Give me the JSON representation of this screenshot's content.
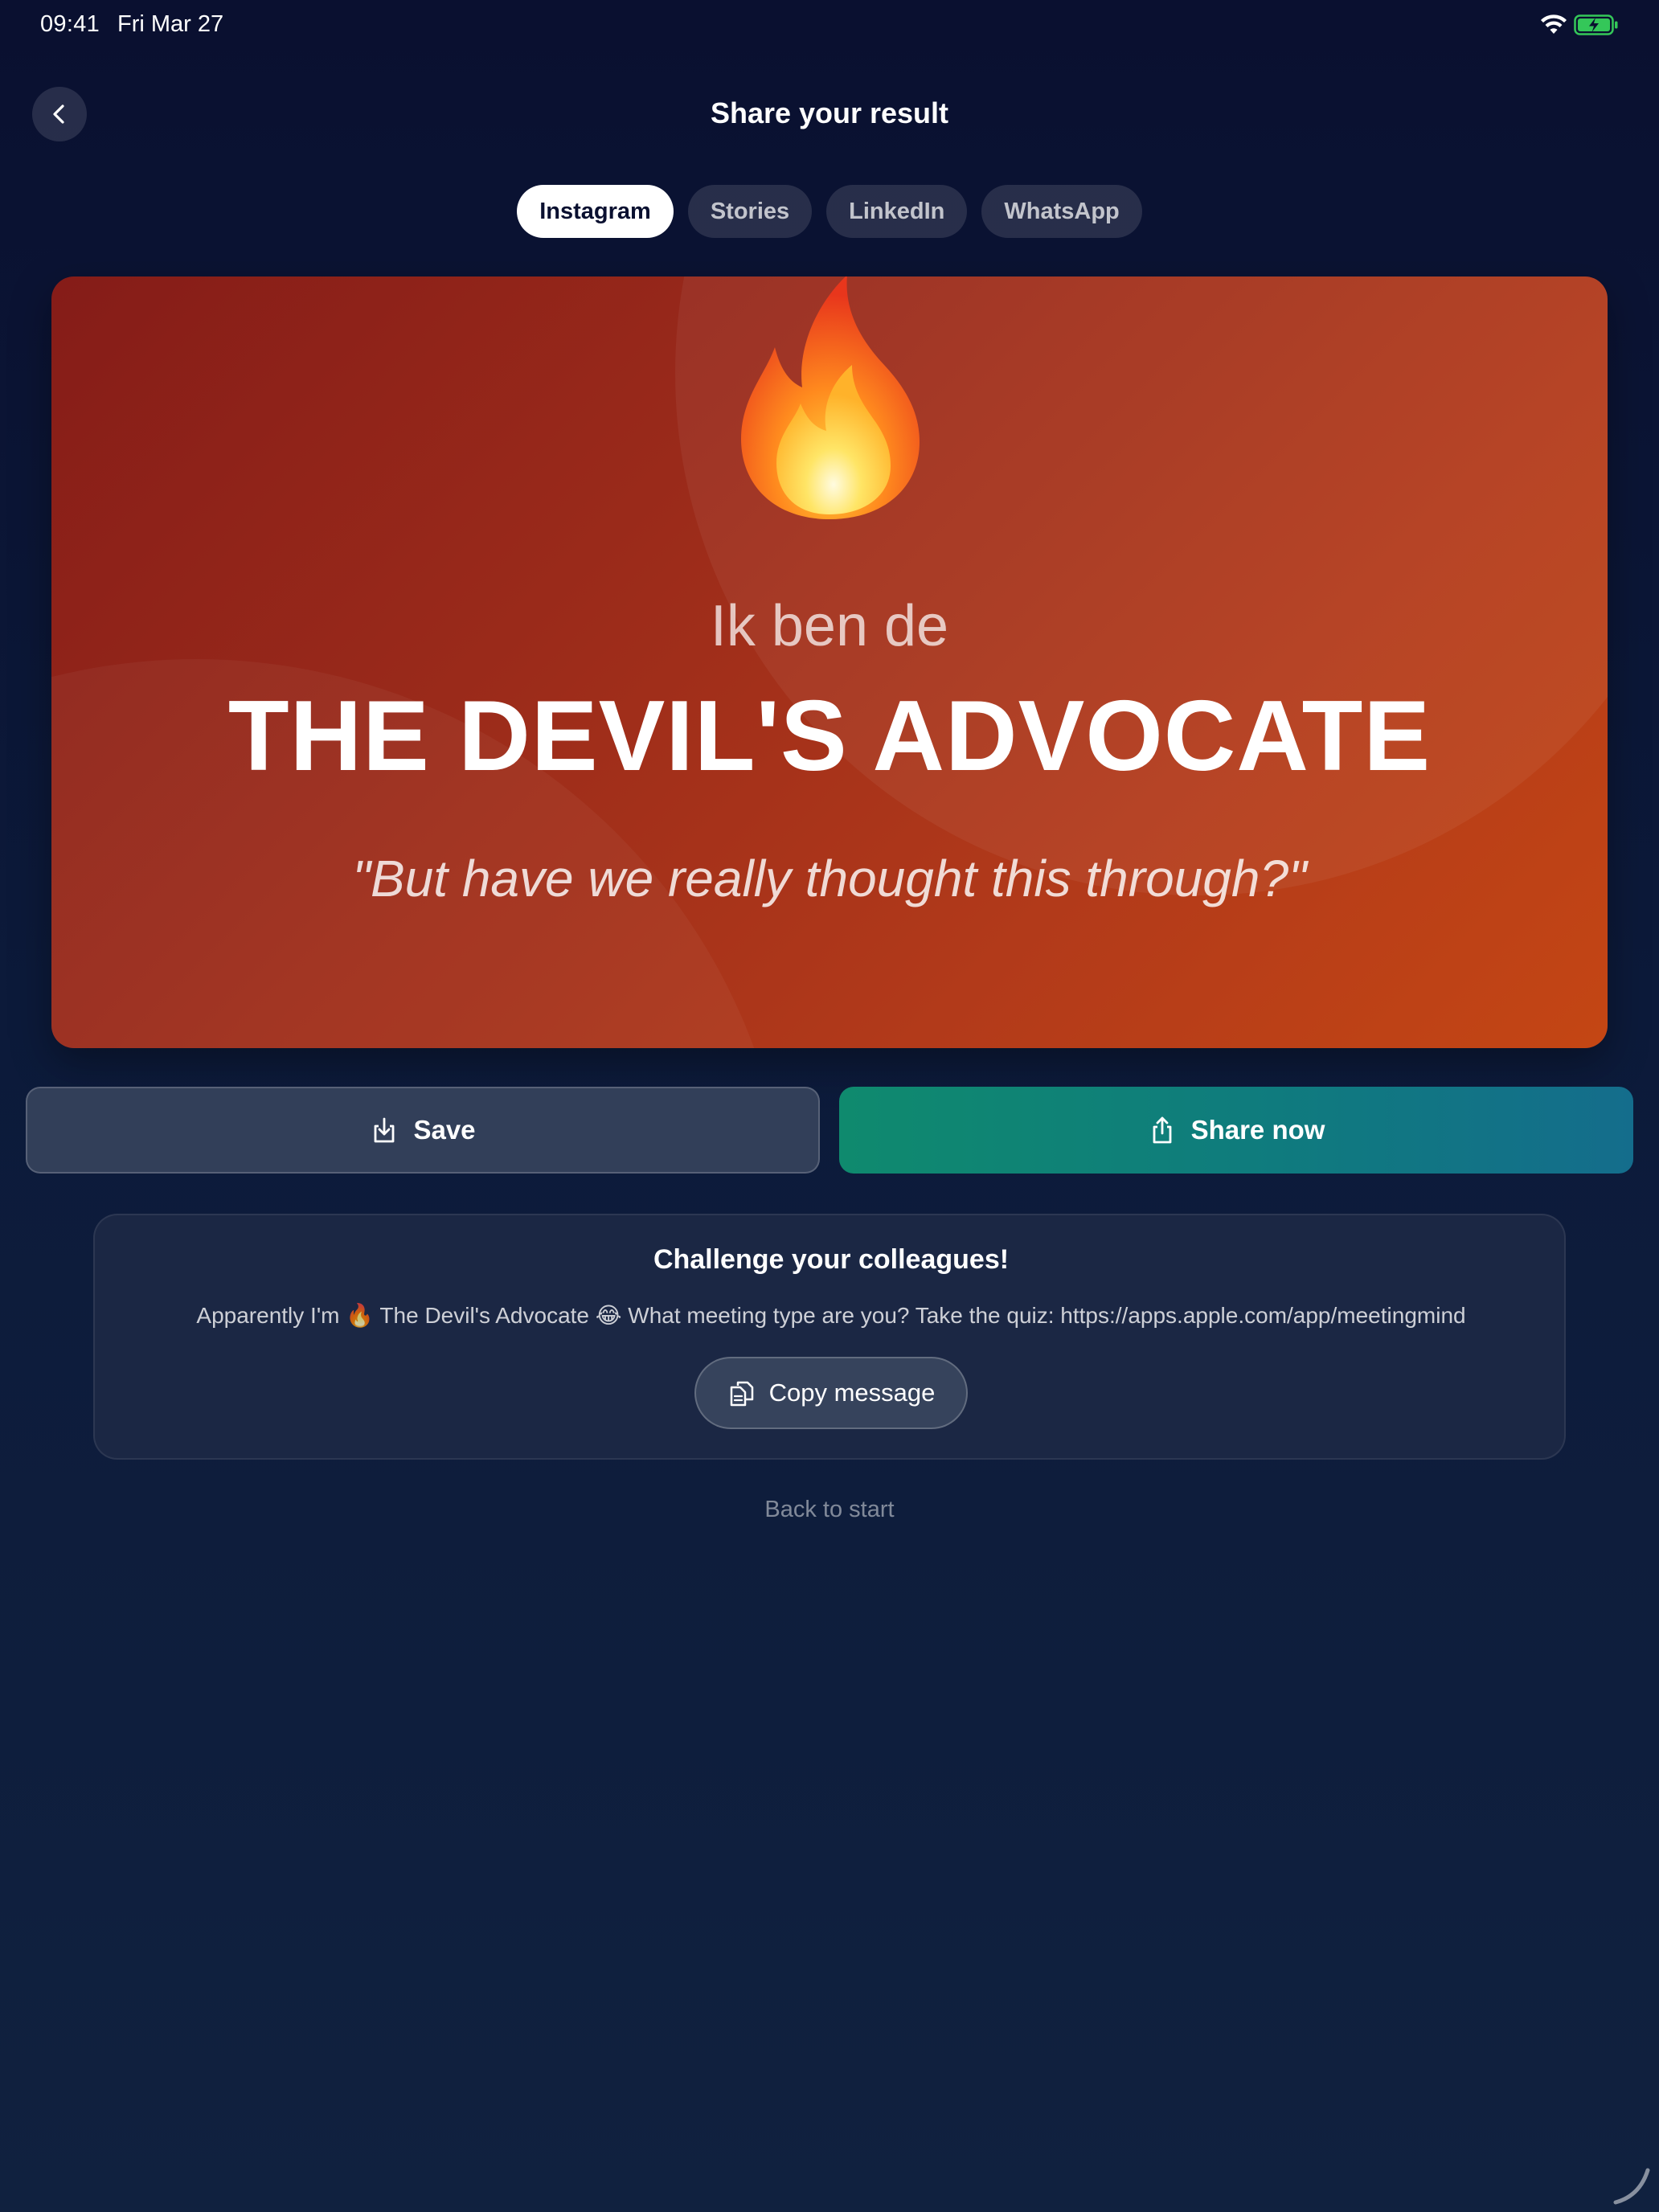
{
  "status_bar": {
    "time": "09:41",
    "date": "Fri Mar 27",
    "icons": [
      "wifi-icon",
      "battery-charging-icon"
    ],
    "battery_color": "#34c759"
  },
  "header": {
    "back_icon": "chevron-left-icon",
    "title": "Share your result"
  },
  "tabs": [
    {
      "label": "Instagram",
      "active": true
    },
    {
      "label": "Stories",
      "active": false
    },
    {
      "label": "LinkedIn",
      "active": false
    },
    {
      "label": "WhatsApp",
      "active": false
    }
  ],
  "result_card": {
    "emoji_icon": "fire-emoji",
    "intro": "Ik ben de",
    "headline": "THE DEVIL'S ADVOCATE",
    "quote": "\"But have we really thought this through?\"",
    "gradient_colors": [
      "#851c18",
      "#c44614"
    ]
  },
  "actions": {
    "save_label": "Save",
    "save_icon": "download-icon",
    "share_label": "Share now",
    "share_icon": "share-icon",
    "share_colors": [
      "#0f8a6e",
      "#146d8c"
    ]
  },
  "challenge": {
    "title": "Challenge your colleagues!",
    "message": "Apparently I'm 🔥 The Devil's Advocate 😂 What meeting type are you? Take the quiz: https://apps.apple.com/app/meetingmind",
    "copy_label": "Copy message",
    "copy_icon": "copy-icon"
  },
  "footer": {
    "back_to_start": "Back to start"
  }
}
